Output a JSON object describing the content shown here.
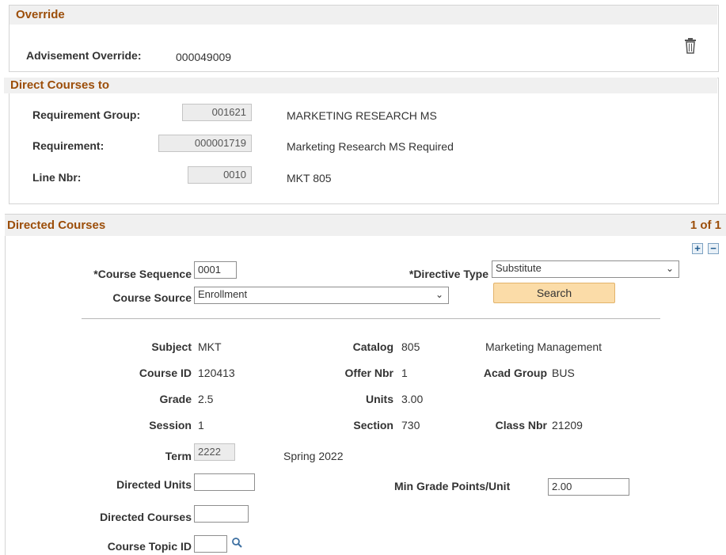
{
  "override": {
    "header": "Override",
    "advisement_label": "Advisement Override:",
    "advisement_value": "000049009"
  },
  "direct": {
    "header": "Direct Courses to",
    "req_group_label": "Requirement Group:",
    "req_group_value": "001621",
    "req_group_desc": "MARKETING RESEARCH MS",
    "requirement_label": "Requirement:",
    "requirement_value": "000001719",
    "requirement_desc": "Marketing Research MS Required",
    "line_label": "Line Nbr:",
    "line_value": "0010",
    "line_desc": "MKT 805"
  },
  "directed": {
    "header": "Directed Courses",
    "counter": "1 of 1",
    "course_seq_label": "*Course Sequence",
    "course_seq_value": "0001",
    "directive_label": "*Directive Type",
    "directive_value": "Substitute",
    "course_source_label": "Course Source",
    "course_source_value": "Enrollment",
    "search_label": "Search",
    "subject_label": "Subject",
    "subject_value": "MKT",
    "catalog_label": "Catalog",
    "catalog_value": "805",
    "course_title": "Marketing Management",
    "course_id_label": "Course ID",
    "course_id_value": "120413",
    "offer_label": "Offer Nbr",
    "offer_value": "1",
    "acad_label": "Acad Group",
    "acad_value": "BUS",
    "grade_label": "Grade",
    "grade_value": "2.5",
    "units_label": "Units",
    "units_value": "3.00",
    "session_label": "Session",
    "session_value": "1",
    "section_label": "Section",
    "section_value": "730",
    "class_label": "Class Nbr",
    "class_value": "21209",
    "term_label": "Term",
    "term_value": "2222",
    "term_desc": "Spring 2022",
    "dir_units_label": "Directed Units",
    "dir_units_value": "",
    "min_grade_label": "Min Grade Points/Unit",
    "min_grade_value": "2.00",
    "dir_courses_label": "Directed Courses",
    "dir_courses_value": "",
    "topic_label": "Course Topic ID",
    "topic_value": ""
  }
}
